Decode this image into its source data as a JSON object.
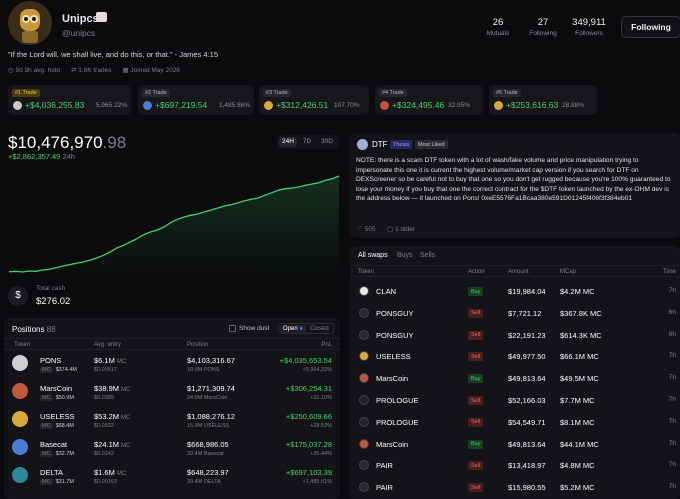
{
  "profile": {
    "name": "Unipcs",
    "handle": "@unipcs",
    "bio": "\"If the Lord will, we shall live, and do this, or that.\" - James 4:15",
    "meta": [
      "9d 9h avg. hold",
      "1.9K trades",
      "Joined May 2026"
    ],
    "stats": [
      {
        "value": "26",
        "label": "Mutuals"
      },
      {
        "value": "27",
        "label": "Following"
      },
      {
        "value": "349,911",
        "label": "Followers"
      }
    ],
    "follow_label": "Following"
  },
  "trades": [
    {
      "tag": "#1 Trade",
      "value": "+$4,036,255.83",
      "pct": "5,965.22%",
      "color": "#c9c9c9"
    },
    {
      "tag": "#2 Trade",
      "value": "+$697,219.54",
      "pct": "1,485.86%",
      "color": "#4a7bd6"
    },
    {
      "tag": "#3 Trade",
      "value": "+$312,426.51",
      "pct": "107.70%",
      "color": "#d9a93a"
    },
    {
      "tag": "#4 Trade",
      "value": "+$324,495.46",
      "pct": "32.95%",
      "color": "#c0563a"
    },
    {
      "tag": "#5 Trade",
      "value": "+$253,616.63",
      "pct": "28.88%",
      "color": "#d9a93a"
    }
  ],
  "portfolio": {
    "value_main": "$10,476,970",
    "value_cents": ".98",
    "change": "+$2,862,357.49",
    "period": "24h",
    "ranges": [
      "24H",
      "7D",
      "30D"
    ],
    "cash_label": "Total cash",
    "cash_value": "$276.02"
  },
  "chart_data": {
    "type": "line",
    "title": "",
    "xlabel": "",
    "ylabel": "",
    "grid": false,
    "series": [
      {
        "values": [
          7.61,
          7.62,
          7.6,
          7.63,
          7.62,
          7.66,
          7.68,
          7.73,
          7.78,
          7.82,
          7.86,
          7.9,
          7.95,
          8.02,
          8.1,
          8.2,
          8.32,
          8.4,
          8.5,
          8.6,
          8.72,
          8.8,
          8.86,
          8.95,
          9.08,
          9.18,
          9.25,
          9.3,
          9.34,
          9.4,
          9.46,
          9.52,
          9.58,
          9.62,
          9.68,
          9.74,
          9.78,
          9.82,
          9.9,
          9.98,
          10.05,
          10.1,
          10.12,
          10.15,
          10.2,
          10.24,
          10.28,
          10.35,
          10.4,
          10.48
        ]
      }
    ]
  },
  "positions": {
    "title": "Positions",
    "count": "88",
    "show_dust": "Show dust",
    "open": "Open",
    "closed": "Closed",
    "columns": [
      "Token",
      "Avg. entry",
      "Position",
      "PnL"
    ],
    "rows": [
      {
        "name": "PONS",
        "mc": "$374.4M",
        "entry": "$6.1M",
        "entry_unit": "MC",
        "entry_sub": "$0.00617",
        "pos": "$4,103,316.67",
        "pos_sub": "10.9M PONS",
        "pnl": "+$4,035,653.54",
        "pnl_pct": "+5,964.33%",
        "color": "#d0d0d0"
      },
      {
        "name": "MarsCoin",
        "mc": "$50.9M",
        "entry": "$38.9M",
        "entry_unit": "MC",
        "entry_sub": "$0.0389",
        "pos": "$1,271,309.74",
        "pos_sub": "24.9M MarsCoin",
        "pnl": "+$306,254.31",
        "pnl_pct": "+31.10%",
        "color": "#c0563a"
      },
      {
        "name": "USELESS",
        "mc": "$68.4M",
        "entry": "$53.2M",
        "entry_unit": "MC",
        "entry_sub": "$0.0532",
        "pos": "$1,088,276.12",
        "pos_sub": "15.9M USELESS",
        "pnl": "+$250,609.66",
        "pnl_pct": "+28.53%",
        "color": "#d9a93a"
      },
      {
        "name": "Basecat",
        "mc": "$32.7M",
        "entry": "$24.1M",
        "entry_unit": "MC",
        "entry_sub": "$0.0242",
        "pos": "$668,986.05",
        "pos_sub": "20.4M Basecat",
        "pnl": "+$175,037.28",
        "pnl_pct": "+35.44%",
        "color": "#4a7bd6"
      },
      {
        "name": "DELTA",
        "mc": "$31.7M",
        "entry": "$1.6M",
        "entry_unit": "MC",
        "entry_sub": "$0.00163",
        "pos": "$648,223.97",
        "pos_sub": "20.4M DELTA",
        "pnl": "+$697,103.39",
        "pnl_pct": "+1,485.61%",
        "color": "#2a8a9a"
      }
    ]
  },
  "post": {
    "token": "DTF",
    "tags": [
      "Thesis",
      "Most Liked"
    ],
    "body": "NOTE: there is a scam DTF token with a lot of wash/fake volume and price manipulation trying to impersonate this one it is current the highest volume/market cap version if you search for DTF on DEXScreener so be careful not to buy that one so you don't get rugged because you're 100% guaranteed to lose your money if you buy that one the correct contract for the $DTF token launched by the ex-OHM dev is the address below — it launched on Pons! 0xeE5576Fa1Bcaa380e591D01245f406f3f384eb01",
    "likes": "505",
    "age": "1 older"
  },
  "swaps": {
    "tabs": [
      "All swaps",
      "Buys",
      "Sells"
    ],
    "columns": [
      "Token",
      "Action",
      "Amount",
      "MCap",
      "Time"
    ],
    "rows": [
      {
        "token": "CLAN",
        "action": "Buy",
        "amount": "$19,984.04",
        "mcap": "$4.2M MC",
        "time": "7h",
        "color": "#e8e8e8"
      },
      {
        "token": "PONSGUY",
        "action": "Sell",
        "amount": "$7,721.12",
        "mcap": "$367.8K MC",
        "time": "6h",
        "color": "#2a2a2a"
      },
      {
        "token": "PONSGUY",
        "action": "Sell",
        "amount": "$22,191.23",
        "mcap": "$614.3K MC",
        "time": "6h",
        "color": "#2a2a2a"
      },
      {
        "token": "USELESS",
        "action": "Sell",
        "amount": "$49,977.50",
        "mcap": "$66.1M MC",
        "time": "7h",
        "color": "#d9a93a"
      },
      {
        "token": "MarsCoin",
        "action": "Buy",
        "amount": "$49,813.64",
        "mcap": "$49.5M MC",
        "time": "7h",
        "color": "#c0563a"
      },
      {
        "token": "PROLOGUE",
        "action": "Sell",
        "amount": "$52,166.03",
        "mcap": "$7.7M MC",
        "time": "7h",
        "color": "#222"
      },
      {
        "token": "PROLOGUE",
        "action": "Sell",
        "amount": "$54,549.71",
        "mcap": "$8.1M MC",
        "time": "7h",
        "color": "#222"
      },
      {
        "token": "MarsCoin",
        "action": "Buy",
        "amount": "$49,813.64",
        "mcap": "$44.1M MC",
        "time": "7h",
        "color": "#c0563a"
      },
      {
        "token": "PAIR",
        "action": "Sell",
        "amount": "$13,418.97",
        "mcap": "$4.8M MC",
        "time": "7h",
        "color": "#2a2a2a"
      },
      {
        "token": "PAIR",
        "action": "Sell",
        "amount": "$15,980.55",
        "mcap": "$5.2M MC",
        "time": "7h",
        "color": "#2a2a2a"
      }
    ]
  }
}
